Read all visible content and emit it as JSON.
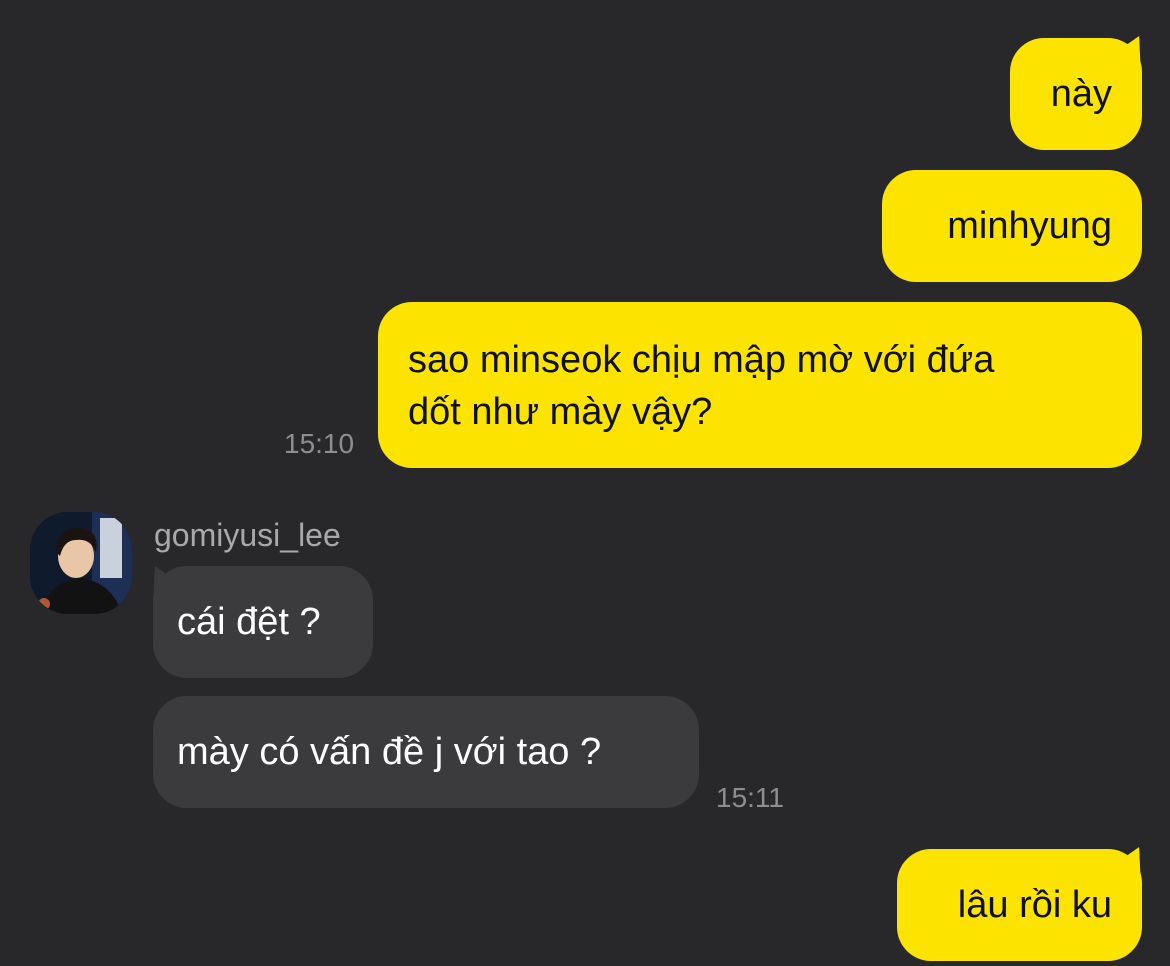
{
  "conversation": {
    "messages": [
      {
        "direction": "outgoing",
        "text": "này"
      },
      {
        "direction": "outgoing",
        "text": "minhyung"
      },
      {
        "direction": "outgoing",
        "lines": [
          "sao minseok chịu mập mờ với đứa",
          "dốt như mày vậy?"
        ],
        "time": "15:10"
      },
      {
        "direction": "incoming",
        "sender": "gomiyusi_lee",
        "text": "cái đệt ?"
      },
      {
        "direction": "incoming",
        "text": "mày có vấn đề j với tao ?",
        "time": "15:11"
      },
      {
        "direction": "outgoing",
        "text": "lâu rồi ku"
      }
    ]
  },
  "colors": {
    "background": "#28282a",
    "outgoing_bubble": "#fde400",
    "incoming_bubble": "#3b3b3d",
    "timestamp": "#8e8e90",
    "sender_name": "#a9a9ab"
  }
}
